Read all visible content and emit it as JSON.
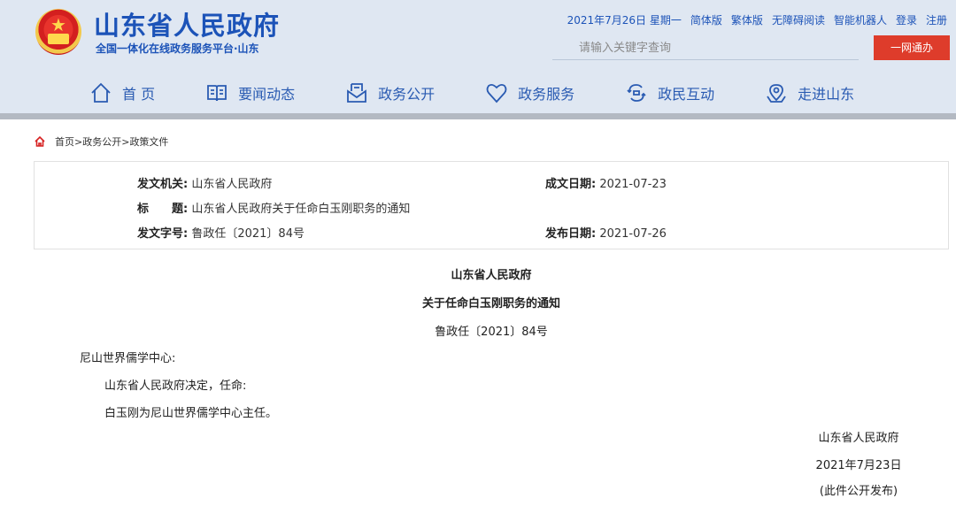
{
  "header": {
    "site_title": "山东省人民政府",
    "site_subtitle": "全国一体化在线政务服务平台·山东",
    "emblem_icon": "national-emblem-icon",
    "topbar": {
      "date": "2021年7月26日",
      "weekday": "星期一",
      "simplified": "简体版",
      "traditional": "繁体版",
      "accessible": "无障碍阅读",
      "robot": "智能机器人",
      "login": "登录",
      "register": "注册"
    },
    "search_placeholder": "请输入关键字查询",
    "one_net_label": "一网通办",
    "accent_color": "#1c53b8",
    "button_color": "#de3c2b"
  },
  "nav": {
    "items": [
      {
        "label": "首 页",
        "icon": "home-icon"
      },
      {
        "label": "要闻动态",
        "icon": "book-icon"
      },
      {
        "label": "政务公开",
        "icon": "inbox-icon"
      },
      {
        "label": "政务服务",
        "icon": "heart-icon"
      },
      {
        "label": "政民互动",
        "icon": "interaction-icon"
      },
      {
        "label": "走进山东",
        "icon": "location-icon"
      }
    ]
  },
  "breadcrumb": {
    "icon": "home-icon",
    "items": [
      "首页",
      "政务公开",
      "政策文件"
    ],
    "sep": ">"
  },
  "meta": {
    "issuer_label": "发文机关:",
    "issuer_value": "山东省人民政府",
    "title_label": "标　　题:",
    "title_value": "山东省人民政府关于任命白玉刚职务的通知",
    "doc_no_label": "发文字号:",
    "doc_no_value": "鲁政任〔2021〕84号",
    "created_label": "成文日期:",
    "created_value": "2021-07-23",
    "published_label": "发布日期:",
    "published_value": "2021-07-26"
  },
  "document": {
    "issuer": "山东省人民政府",
    "title": "关于任命白玉刚职务的通知",
    "doc_no": "鲁政任〔2021〕84号",
    "recipient": "尼山世界儒学中心:",
    "para1": "山东省人民政府决定，任命:",
    "para2": "白玉刚为尼山世界儒学中心主任。",
    "signature": "山东省人民政府",
    "date": "2021年7月23日",
    "note": "(此件公开发布)"
  }
}
